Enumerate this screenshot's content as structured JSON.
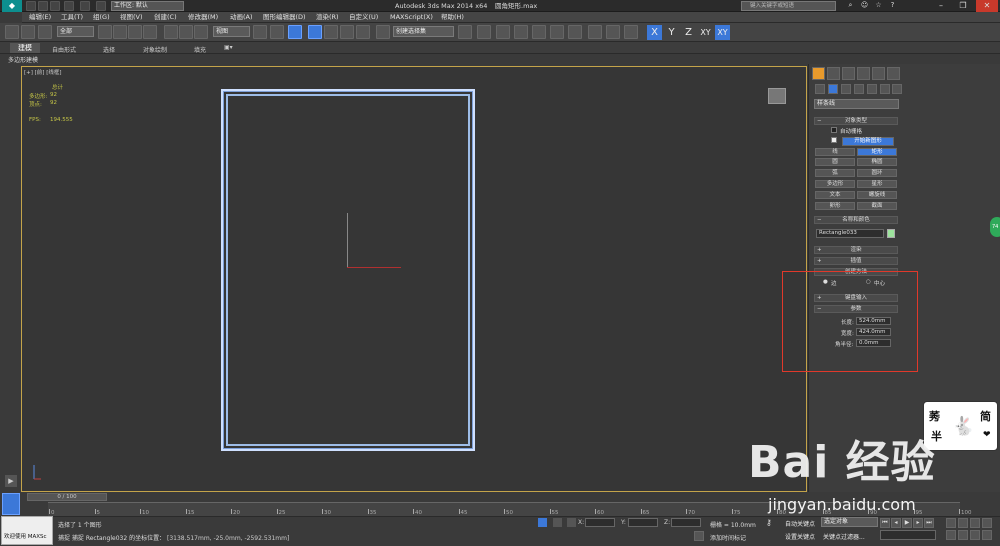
{
  "titlebar": {
    "workspace": "工作区: 默认",
    "app_title": "Autodesk 3ds Max  2014 x64",
    "file_name": "圆角矩形.max",
    "search_placeholder": "键入关键字或短语"
  },
  "menu": [
    "编辑(E)",
    "工具(T)",
    "组(G)",
    "视图(V)",
    "创建(C)",
    "修改器(M)",
    "动画(A)",
    "图形编辑器(D)",
    "渲染(R)",
    "自定义(U)",
    "MAXScript(X)",
    "帮助(H)"
  ],
  "toolbar": {
    "selection_filter": "全部",
    "ref_coord": "视图",
    "named_selection": "创建选择集",
    "axes": [
      "X",
      "Y",
      "Z",
      "XY",
      "XY"
    ]
  },
  "ribbon": {
    "tabs": [
      "建模",
      "自由形式",
      "选择",
      "对象绘制",
      "填充"
    ],
    "mode_label": "多边形建模"
  },
  "viewport": {
    "label": "[+] [前] [线框]",
    "stats_total": "总计",
    "stats": [
      {
        "label": "多边形:",
        "value": "92"
      },
      {
        "label": "顶点:",
        "value": "92"
      }
    ],
    "fps_label": "FPS:",
    "fps_value": "194.555"
  },
  "command_panel": {
    "category": "样条线",
    "object_type_title": "对象类型",
    "autogrid": "自动栅格",
    "start_new_shape": "开始新图形",
    "shape_buttons": [
      "线",
      "矩形",
      "圆",
      "椭圆",
      "弧",
      "圆环",
      "多边形",
      "星形",
      "文本",
      "螺旋线",
      "卵形",
      "截面"
    ],
    "name_color_title": "名称和颜色",
    "object_name": "Rectangle033",
    "swatch_color": "#9de39d",
    "rollouts": [
      "渲染",
      "插值",
      "创建方法"
    ],
    "creation_methods": [
      "边",
      "中心"
    ],
    "keyboard_entry": "键盘输入",
    "params_title": "参数",
    "params": [
      {
        "label": "长度:",
        "value": "524.0mm"
      },
      {
        "label": "宽度:",
        "value": "424.0mm"
      },
      {
        "label": "角半径:",
        "value": "0.0mm"
      }
    ]
  },
  "timeline": {
    "counter": "0 / 100",
    "ticks": [
      "0",
      "5",
      "10",
      "15",
      "20",
      "25",
      "30",
      "35",
      "40",
      "45",
      "50",
      "55",
      "60",
      "65",
      "70",
      "75",
      "80",
      "85",
      "90",
      "95",
      "100"
    ]
  },
  "status": {
    "maxscript": "欢迎使用 MAXSc",
    "selected": "选择了 1 个图形",
    "prompt_prefix": "捕捉 捕捉 Rectangle032 的坐标位置：",
    "prompt_coords": "[3138.517mm, -25.0mm, -2592.531mm]",
    "x_label": "X:",
    "y_label": "Y:",
    "z_label": "Z:",
    "grid": "栅格 = 10.0mm",
    "add_time_tag": "添加时间标记",
    "auto_key": "自动关键点",
    "selection_set": "选定对象",
    "set_key": "设置关键点",
    "key_filters": "关键点过滤器..."
  },
  "watermark": {
    "logo": "Bai 经验",
    "url": "jingyan.baidu.com"
  },
  "sticker": {
    "chars": [
      "莠",
      "半",
      "简"
    ]
  },
  "badge": "74"
}
